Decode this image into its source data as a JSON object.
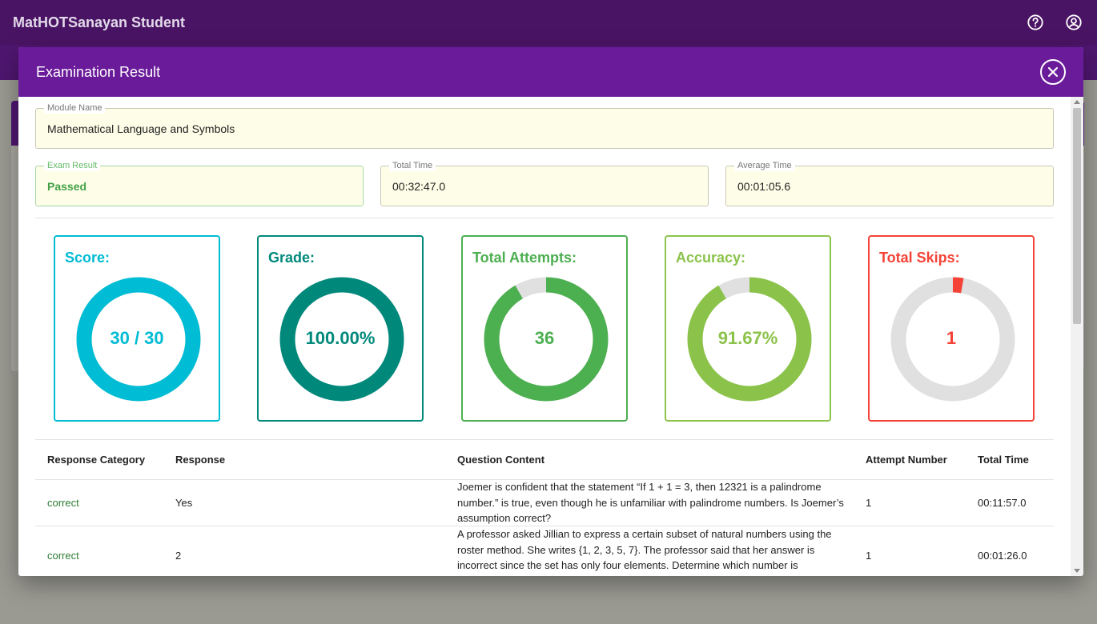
{
  "app": {
    "title": "MatHOTSanayan Student"
  },
  "dialog": {
    "title": "Examination Result",
    "module": {
      "label": "Module Name",
      "value": "Mathematical Language and Symbols"
    },
    "exam_result": {
      "label": "Exam Result",
      "value": "Passed"
    },
    "total_time": {
      "label": "Total Time",
      "value": "00:32:47.0"
    },
    "average_time": {
      "label": "Average Time",
      "value": "00:01:05.6"
    }
  },
  "stats": [
    {
      "label": "Score:",
      "value": "30 / 30",
      "color": "#00bcd4",
      "fraction": 1.0
    },
    {
      "label": "Grade:",
      "value": "100.00%",
      "color": "#00897b",
      "fraction": 1.0
    },
    {
      "label": "Total Attempts:",
      "value": "36",
      "color": "#4caf50",
      "fraction": 0.9167
    },
    {
      "label": "Accuracy:",
      "value": "91.67%",
      "color": "#8bc34a",
      "fraction": 0.9167
    },
    {
      "label": "Total Skips:",
      "value": "1",
      "color": "#f44336",
      "fraction": 0.0278
    }
  ],
  "ring_track_color": "#e0e0e0",
  "table": {
    "headers": {
      "category": "Response Category",
      "response": "Response",
      "question": "Question Content",
      "attempt": "Attempt Number",
      "time": "Total Time"
    },
    "rows": [
      {
        "category": "correct",
        "response": "Yes",
        "question": "Joemer is confident that the statement “If 1 + 1 = 3, then 12321 is a palindrome number.” is true, even though he is unfamiliar with palindrome numbers. Is Joemer’s assumption correct?",
        "attempt": "1",
        "time": "00:11:57.0"
      },
      {
        "category": "correct",
        "response": "2",
        "question": "A professor asked Jillian to express a certain subset of natural numbers using the roster method. She writes {1, 2, 3, 5, 7}. The professor said that her answer is incorrect since the set has only four elements. Determine which number is",
        "attempt": "1",
        "time": "00:01:26.0"
      }
    ]
  }
}
